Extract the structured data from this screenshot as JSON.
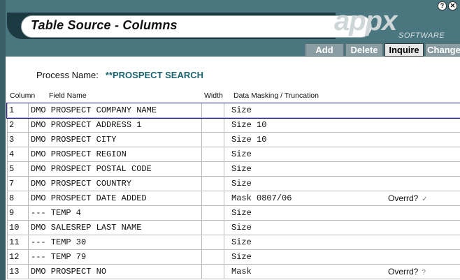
{
  "window": {
    "title": "Table Source - Columns",
    "help_glyph": "?",
    "close_glyph": "✕"
  },
  "logo": {
    "word": "appx",
    "sub": "SOFTWARE"
  },
  "toolbar": [
    {
      "label": "Add",
      "active": false
    },
    {
      "label": "Delete",
      "active": false
    },
    {
      "label": "Inquire",
      "active": true
    },
    {
      "label": "Change",
      "active": false
    }
  ],
  "process": {
    "label": "Process Name:",
    "value": "**PROSPECT SEARCH"
  },
  "columns": {
    "column": "Column",
    "field": "Field Name",
    "width": "Width",
    "mask": "Data Masking / Truncation"
  },
  "rows": [
    {
      "col": "1",
      "field": "DMO PROSPECT COMPANY NAME",
      "width": "",
      "mask": "Size",
      "overrd": "",
      "mark": ""
    },
    {
      "col": "2",
      "field": "DMO PROSPECT ADDRESS 1",
      "width": "",
      "mask": "Size 10",
      "overrd": "",
      "mark": ""
    },
    {
      "col": "3",
      "field": "DMO PROSPECT CITY",
      "width": "",
      "mask": "Size 10",
      "overrd": "",
      "mark": ""
    },
    {
      "col": "4",
      "field": "DMO PROSPECT REGION",
      "width": "",
      "mask": "Size",
      "overrd": "",
      "mark": ""
    },
    {
      "col": "5",
      "field": "DMO PROSPECT POSTAL CODE",
      "width": "",
      "mask": "Size",
      "overrd": "",
      "mark": ""
    },
    {
      "col": "7",
      "field": "DMO PROSPECT COUNTRY",
      "width": "",
      "mask": "Size",
      "overrd": "",
      "mark": ""
    },
    {
      "col": "8",
      "field": "DMO PROSPECT DATE ADDED",
      "width": "",
      "mask": "Mask 0807/06",
      "overrd": "Overrd?",
      "mark": "✓"
    },
    {
      "col": "9",
      "field": "--- TEMP 4",
      "width": "",
      "mask": "Size",
      "overrd": "",
      "mark": ""
    },
    {
      "col": "10",
      "field": "DMO SALESREP LAST NAME",
      "width": "",
      "mask": "Size",
      "overrd": "",
      "mark": ""
    },
    {
      "col": "11",
      "field": "--- TEMP 30",
      "width": "",
      "mask": "Size",
      "overrd": "",
      "mark": ""
    },
    {
      "col": "12",
      "field": "--- TEMP 79",
      "width": "",
      "mask": "Size",
      "overrd": "",
      "mark": ""
    },
    {
      "col": "13",
      "field": "DMO PROSPECT NO",
      "width": "",
      "mask": "Mask",
      "overrd": "Overrd?",
      "mark": "?"
    }
  ]
}
